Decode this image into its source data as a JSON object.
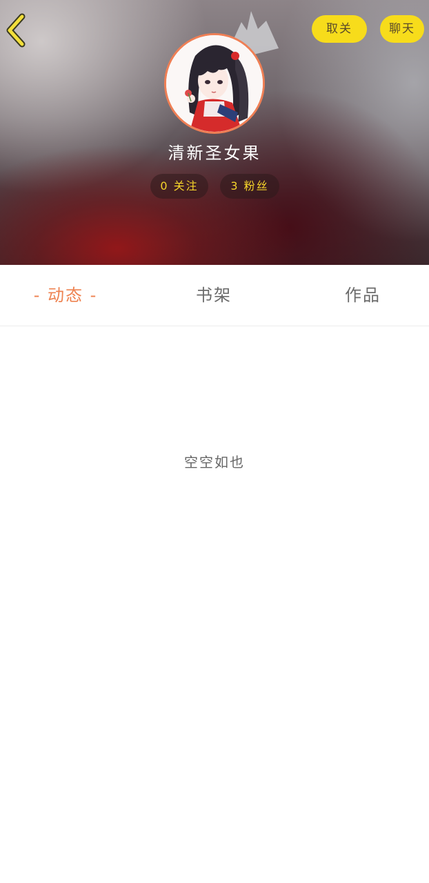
{
  "header": {
    "back_icon": "back-arrow-icon",
    "unfollow_label": "取关",
    "chat_label": "聊天",
    "crown_icon": "crown-icon",
    "username": "清新圣女果",
    "stats": {
      "follow": "0 关注",
      "fans": "3 粉丝"
    }
  },
  "tabs": [
    {
      "label": "- 动态 -",
      "active": true
    },
    {
      "label": "书架",
      "active": false
    },
    {
      "label": "作品",
      "active": false
    }
  ],
  "empty_state": "空空如也",
  "colors": {
    "accent_yellow": "#f7dc1b",
    "active_tab": "#ee8250",
    "avatar_border": "#ef7f55"
  }
}
